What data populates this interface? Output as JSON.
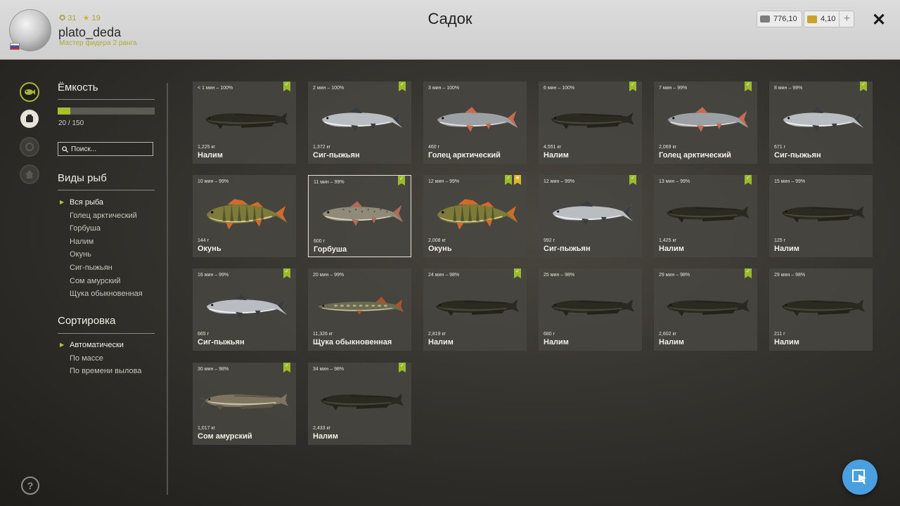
{
  "header": {
    "player": {
      "coins": "31",
      "stars": "19",
      "name": "plato_deda",
      "rank": "Мастер фидера 2 ранга"
    },
    "title": "Садок",
    "currency": {
      "silver": "776,10",
      "gold": "4,10",
      "add": "+"
    },
    "close": "✕"
  },
  "sidebar": {
    "capacity": {
      "title": "Ёмкость",
      "current": 20,
      "max": 150,
      "text": "20 / 150"
    },
    "search_placeholder": "Поиск...",
    "species": {
      "title": "Виды рыб",
      "items": [
        "Вся рыба",
        "Голец арктический",
        "Горбуша",
        "Налим",
        "Окунь",
        "Сиг-пыжьян",
        "Сом амурский",
        "Щука обыкновенная"
      ],
      "selected": 0
    },
    "sort": {
      "title": "Сортировка",
      "items": [
        "Автоматически",
        "По массе",
        "По времени вылова"
      ],
      "selected": 0
    }
  },
  "icons": {
    "nav": [
      "fish-icon",
      "keepnet-icon",
      "lure-icon",
      "home-icon"
    ],
    "help": "?",
    "fab": "cursor-icon"
  },
  "colors": {
    "accent": "#a9bd2d",
    "badge_green": "#9cbb2c",
    "badge_gold": "#e0b630",
    "fab": "#4a9fe0"
  },
  "fish": [
    {
      "time": "< 1 мин – 100%",
      "weight": "1,225 кг",
      "name": "Налим",
      "kind": "burbot",
      "badges": [
        "green"
      ]
    },
    {
      "time": "2 мин – 100%",
      "weight": "1,372 кг",
      "name": "Сиг-пыжьян",
      "kind": "whitefish",
      "badges": [
        "green"
      ]
    },
    {
      "time": "3 мин – 100%",
      "weight": "460 г",
      "name": "Голец арктический",
      "kind": "char",
      "badges": []
    },
    {
      "time": "6 мин – 100%",
      "weight": "4,551 кг",
      "name": "Налим",
      "kind": "burbot",
      "badges": [
        "green"
      ]
    },
    {
      "time": "7 мин – 99%",
      "weight": "2,069 кг",
      "name": "Голец арктический",
      "kind": "char",
      "badges": [
        "green"
      ]
    },
    {
      "time": "8 мин – 99%",
      "weight": "671 г",
      "name": "Сиг-пыжьян",
      "kind": "whitefish",
      "badges": [
        "green"
      ]
    },
    {
      "time": "10 мин – 99%",
      "weight": "144 г",
      "name": "Окунь",
      "kind": "perch",
      "badges": []
    },
    {
      "time": "11 мин – 99%",
      "weight": "600 г",
      "name": "Горбуша",
      "kind": "salmon",
      "badges": [
        "green"
      ],
      "selected": true
    },
    {
      "time": "12 мин – 99%",
      "weight": "2,008 кг",
      "name": "Окунь",
      "kind": "perch",
      "badges": [
        "green",
        "gold"
      ]
    },
    {
      "time": "12 мин – 99%",
      "weight": "992 г",
      "name": "Сиг-пыжьян",
      "kind": "whitefish",
      "badges": [
        "green"
      ]
    },
    {
      "time": "13 мин – 99%",
      "weight": "1,425 кг",
      "name": "Налим",
      "kind": "burbot",
      "badges": [
        "green"
      ]
    },
    {
      "time": "15 мин – 99%",
      "weight": "125 г",
      "name": "Налим",
      "kind": "burbot",
      "badges": []
    },
    {
      "time": "16 мин – 99%",
      "weight": "665 г",
      "name": "Сиг-пыжьян",
      "kind": "whitefish",
      "badges": [
        "green"
      ]
    },
    {
      "time": "20 мин – 99%",
      "weight": "11,326 кг",
      "name": "Щука обыкновенная",
      "kind": "pike",
      "badges": []
    },
    {
      "time": "24 мин – 98%",
      "weight": "2,819 кг",
      "name": "Налим",
      "kind": "burbot",
      "badges": [
        "green"
      ]
    },
    {
      "time": "25 мин – 98%",
      "weight": "680 г",
      "name": "Налим",
      "kind": "burbot",
      "badges": []
    },
    {
      "time": "29 мин – 98%",
      "weight": "2,602 кг",
      "name": "Налим",
      "kind": "burbot",
      "badges": [
        "green"
      ]
    },
    {
      "time": "29 мин – 98%",
      "weight": "211 г",
      "name": "Налим",
      "kind": "burbot",
      "badges": []
    },
    {
      "time": "30 мин – 98%",
      "weight": "1,017 кг",
      "name": "Сом амурский",
      "kind": "catfish",
      "badges": [
        "green"
      ]
    },
    {
      "time": "34 мин – 98%",
      "weight": "2,433 кг",
      "name": "Налим",
      "kind": "burbot",
      "badges": [
        "green"
      ]
    }
  ]
}
